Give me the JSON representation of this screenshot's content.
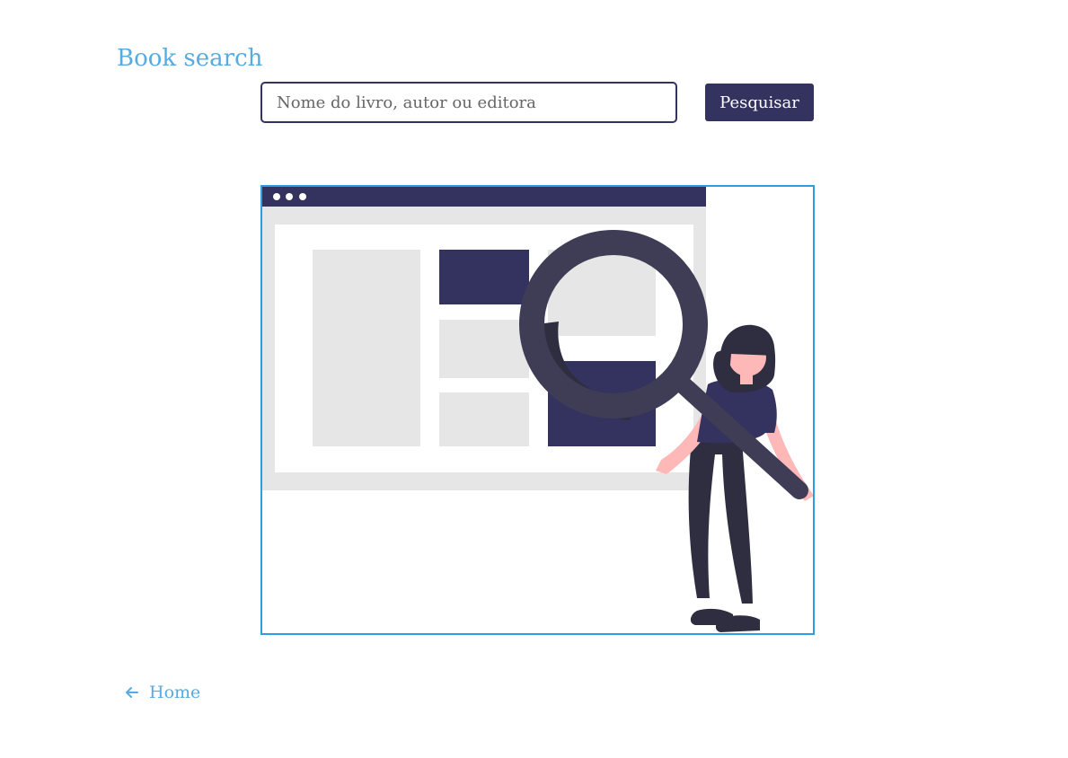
{
  "header": {
    "title": "Book search"
  },
  "search": {
    "placeholder": "Nome do livro, autor ou editora",
    "value": "",
    "button_label": "Pesquisar"
  },
  "illustration": {
    "icon": "woman-magnifying-glass-search-illustration"
  },
  "footer": {
    "home_label": "Home",
    "home_icon": "arrow-left-icon"
  },
  "colors": {
    "accent": "#56abe0",
    "primary": "#34325f",
    "frame_border": "#2f9be0",
    "placeholder_gray": "#e6e6e6",
    "magnifier": "#3f3d56",
    "skin": "#ffb8b8",
    "dark": "#2f2e41"
  }
}
